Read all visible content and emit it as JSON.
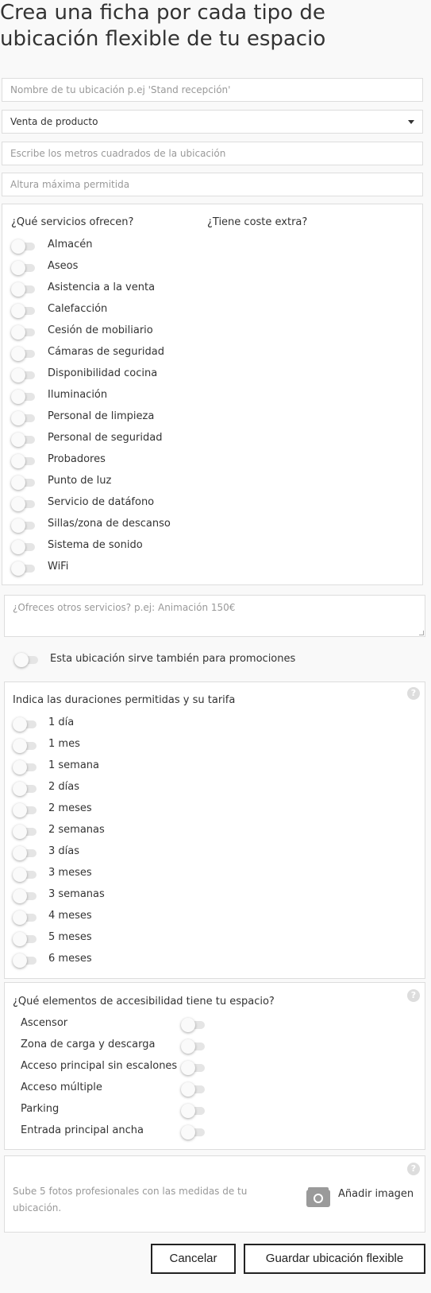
{
  "page_title": "Crea una ficha por cada tipo de ubicación flexible de tu espacio",
  "fields": {
    "name_placeholder": "Nombre de tu ubicación p.ej 'Stand recepción'",
    "type_selected": "Venta de producto",
    "area_placeholder": "Escribe los metros cuadrados de la ubicación",
    "height_placeholder": "Altura máxima permitida"
  },
  "services": {
    "header": "¿Qué servicios ofrecen?",
    "extra_cost_header": "¿Tiene coste extra?",
    "items": [
      {
        "label": "Almacén",
        "on": false
      },
      {
        "label": "Aseos",
        "on": false
      },
      {
        "label": "Asistencia a la venta",
        "on": false
      },
      {
        "label": "Calefacción",
        "on": false
      },
      {
        "label": "Cesión de mobiliario",
        "on": false
      },
      {
        "label": "Cámaras de seguridad",
        "on": false
      },
      {
        "label": "Disponibilidad cocina",
        "on": false
      },
      {
        "label": "Iluminación",
        "on": false
      },
      {
        "label": "Personal de limpieza",
        "on": false
      },
      {
        "label": "Personal de seguridad",
        "on": false
      },
      {
        "label": "Probadores",
        "on": false
      },
      {
        "label": "Punto de luz",
        "on": false
      },
      {
        "label": "Servicio de datáfono",
        "on": false
      },
      {
        "label": "Sillas/zona de descanso",
        "on": false
      },
      {
        "label": "Sistema de sonido",
        "on": false
      },
      {
        "label": "WiFi",
        "on": false
      }
    ]
  },
  "other_services_placeholder": "¿Ofreces otros servicios? p.ej: Animación 150€",
  "promotions": {
    "label": "Esta ubicación sirve también para promociones",
    "on": false
  },
  "durations": {
    "header": "Indica las duraciones permitidas y su tarifa",
    "help": "?",
    "items": [
      {
        "label": "1 día",
        "on": false
      },
      {
        "label": "1 mes",
        "on": false
      },
      {
        "label": "1 semana",
        "on": false
      },
      {
        "label": "2 días",
        "on": false
      },
      {
        "label": "2 meses",
        "on": false
      },
      {
        "label": "2 semanas",
        "on": false
      },
      {
        "label": "3 días",
        "on": false
      },
      {
        "label": "3 meses",
        "on": false
      },
      {
        "label": "3 semanas",
        "on": false
      },
      {
        "label": "4 meses",
        "on": false
      },
      {
        "label": "5 meses",
        "on": false
      },
      {
        "label": "6 meses",
        "on": false
      }
    ]
  },
  "accessibility": {
    "header": "¿Qué elementos de accesibilidad tiene tu espacio?",
    "help": "?",
    "items": [
      {
        "label": "Ascensor",
        "on": false
      },
      {
        "label": "Zona de carga y descarga",
        "on": false
      },
      {
        "label": "Acceso principal sin escalones",
        "on": false
      },
      {
        "label": "Acceso múltiple",
        "on": false
      },
      {
        "label": "Parking",
        "on": false
      },
      {
        "label": "Entrada principal ancha",
        "on": false
      }
    ]
  },
  "photos": {
    "help": "?",
    "text": "Sube 5 fotos profesionales con las medidas de tu ubicación.",
    "add_label": "Añadir imagen"
  },
  "buttons": {
    "cancel": "Cancelar",
    "save": "Guardar ubicación flexible"
  }
}
